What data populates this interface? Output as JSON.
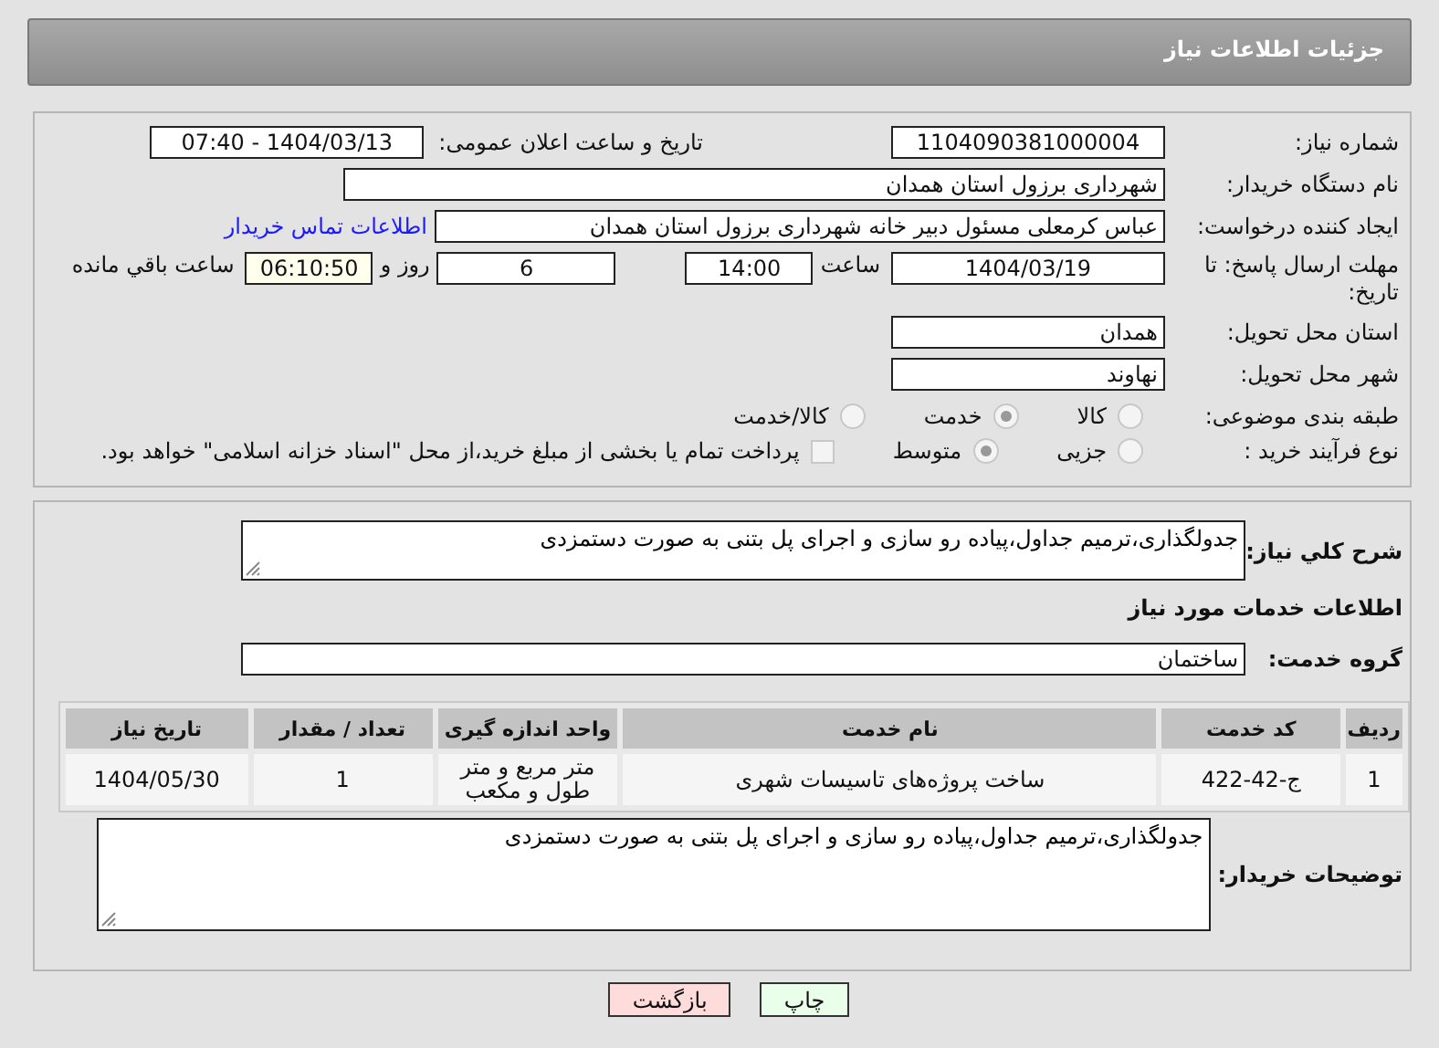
{
  "header": {
    "title": "جزئیات اطلاعات نیاز"
  },
  "need_info": {
    "need_number": {
      "label": "شماره نیاز:",
      "value": "1104090381000004"
    },
    "announce": {
      "label": "تاریخ و ساعت اعلان عمومی:",
      "value": "1404/03/13 - 07:40"
    },
    "buyer": {
      "label": "نام دستگاه خریدار:",
      "value": "شهرداری برزول استان همدان"
    },
    "creator": {
      "label": "ایجاد کننده درخواست:",
      "value": "عباس  کرمعلی مسئول دبیر خانه شهرداری برزول استان همدان",
      "link": "اطلاعات تماس خریدار"
    },
    "deadline": {
      "label": "مهلت ارسال پاسخ: تا تاریخ:",
      "date": "1404/03/19",
      "time_label": "ساعت",
      "time": "14:00",
      "days": "6",
      "days_label": "روز و",
      "remaining": "06:10:50",
      "remaining_label": "ساعت باقي مانده"
    },
    "province": {
      "label": "استان محل تحویل:",
      "value": "همدان"
    },
    "city": {
      "label": "شهر محل تحویل:",
      "value": "نهاوند"
    },
    "category": {
      "label": "طبقه بندی موضوعی:",
      "options": [
        {
          "label": "کالا",
          "selected": false
        },
        {
          "label": "خدمت",
          "selected": true
        },
        {
          "label": "کالا/خدمت",
          "selected": false
        }
      ]
    },
    "process": {
      "label": "نوع فرآیند خرید :",
      "options": [
        {
          "label": "جزیی",
          "selected": false
        },
        {
          "label": "متوسط",
          "selected": true
        }
      ],
      "payment": {
        "checked": false,
        "text": "پرداخت تمام یا بخشی از مبلغ خرید،از محل \"اسناد خزانه اسلامی\" خواهد بود."
      }
    }
  },
  "services": {
    "description": {
      "label": "شرح کلي نياز:",
      "value": "جدولگذاری،ترمیم جداول،پیاده رو سازی و اجرای پل بتنی به صورت دستمزدی"
    },
    "section_title": "اطلاعات خدمات مورد نیاز",
    "group": {
      "label": "گروه خدمت:",
      "value": "ساختمان"
    },
    "table": {
      "columns": [
        "ردیف",
        "کد خدمت",
        "نام خدمت",
        "واحد اندازه گیری",
        "تعداد / مقدار",
        "تاریخ نیاز"
      ],
      "rows": [
        [
          "1",
          "ج-42-422",
          "ساخت پروژه‌های تاسیسات شهری",
          "متر مربع و متر طول و مکعب",
          "1",
          "1404/05/30"
        ]
      ]
    },
    "buyer_notes": {
      "label": "توضیحات خریدار:",
      "value": "جدولگذاری،ترمیم جداول،پیاده رو سازی و اجرای پل بتنی به صورت دستمزدی"
    }
  },
  "buttons": [
    {
      "kind": "print",
      "label": "چاپ"
    },
    {
      "kind": "back",
      "label": "بازگشت"
    }
  ]
}
